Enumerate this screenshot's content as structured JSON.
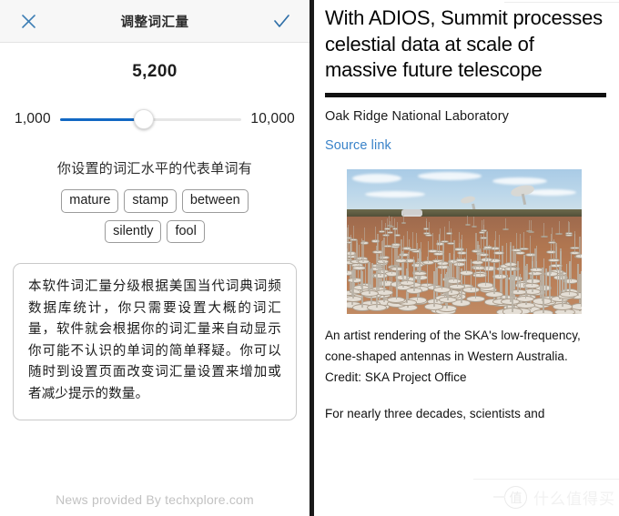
{
  "dialog": {
    "title": "调整词汇量",
    "close_icon": "close-icon",
    "confirm_icon": "check-icon",
    "value_display": "5,200",
    "slider": {
      "min_label": "1,000",
      "max_label": "10,000",
      "min": 1000,
      "max": 10000,
      "value": 5200,
      "fill_percent": 46,
      "fill_color": "#1268c3",
      "track_color": "#e6e6e6"
    },
    "words_caption": "你设置的词汇水平的代表单词有",
    "sample_words_row1": [
      "mature",
      "stamp",
      "between"
    ],
    "sample_words_row2": [
      "silently",
      "fool"
    ],
    "info_text": "本软件词汇量分级根据美国当代词典词频数据库统计，你只需要设置大概的词汇量，软件就会根据你的词汇量来自动显示你可能不认识的单词的简单释疑。你可以随时到设置页面改变词汇量设置来增加或者减少提示的数量。",
    "footer_note": "News provided By techxplore.com"
  },
  "article": {
    "headline": "With ADIOS, Summit processes celestial data at scale of massive future telescope",
    "source": "Oak Ridge National Laboratory",
    "source_link_label": "Source link",
    "photo_caption": "An artist rendering of the SKA's low-frequency, cone-shaped antennas in Western Australia. Credit: SKA Project Office",
    "body_paragraph": "For nearly three decades, scientists and",
    "photo_alt": "antenna-array-photo"
  },
  "watermark": {
    "badge_char": "值",
    "text": "什么值得买"
  }
}
